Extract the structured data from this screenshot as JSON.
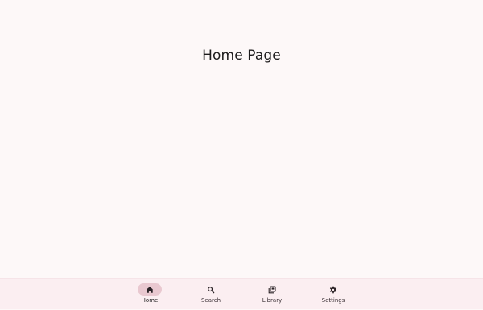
{
  "page": {
    "title": "Home Page"
  },
  "nav": {
    "items": [
      {
        "label": "Home",
        "icon": "home-icon",
        "active": true
      },
      {
        "label": "Search",
        "icon": "search-icon",
        "active": false
      },
      {
        "label": "Library",
        "icon": "library-icon",
        "active": false
      },
      {
        "label": "Settings",
        "icon": "settings-icon",
        "active": false
      }
    ]
  },
  "colors": {
    "background": "#fdf8f8",
    "nav_background": "#fbeef1",
    "active_indicator": "#e9c8d0"
  }
}
